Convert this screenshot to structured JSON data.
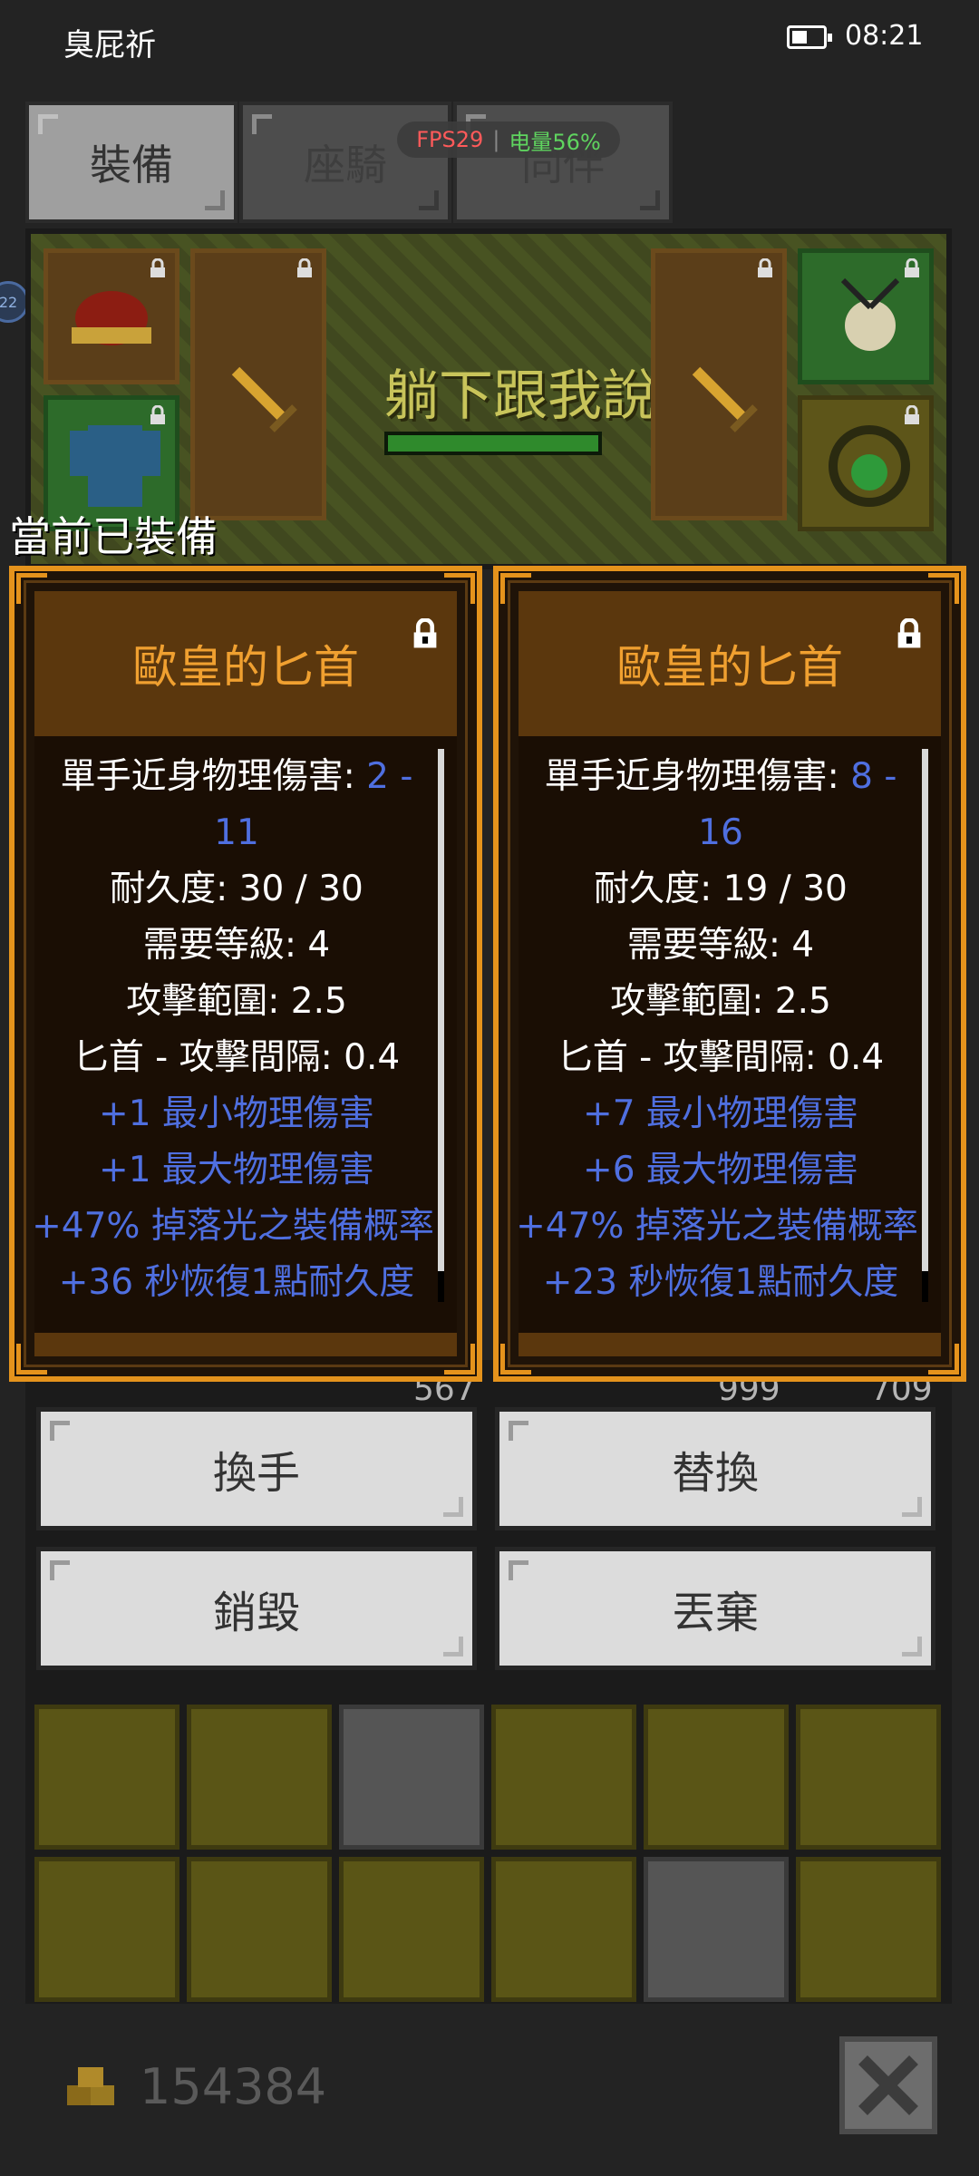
{
  "status_bar": {
    "carrier": "臭屁祈",
    "time": "08:21",
    "battery_icon": "battery-icon"
  },
  "overlay": {
    "fps": "FPS29",
    "separator": "|",
    "battery": "电量56%"
  },
  "tabs": [
    {
      "label": "裝備",
      "active": true
    },
    {
      "label": "座騎",
      "active": false
    },
    {
      "label": "同伴",
      "active": false
    }
  ],
  "scene": {
    "title": "躺下跟我說",
    "hp_fraction": 1.0
  },
  "equipped_caption": "當前已裝備",
  "cards": [
    {
      "name": "歐皇的匕首",
      "lines": [
        {
          "label": "單手近身物理傷害: ",
          "value": "2 - 11"
        },
        {
          "text": "耐久度: 30 / 30"
        },
        {
          "text": "需要等級: 4"
        },
        {
          "text": "攻擊範圍: 2.5"
        },
        {
          "text": "匕首 - 攻擊間隔: 0.4"
        }
      ],
      "bonuses": [
        "+1 最小物理傷害",
        "+1 最大物理傷害",
        "+47% 掉落光之裝備概率",
        "+36 秒恢復1點耐久度"
      ]
    },
    {
      "name": "歐皇的匕首",
      "lines": [
        {
          "label": "單手近身物理傷害: ",
          "value": "8 - 16"
        },
        {
          "text": "耐久度: 19 / 30"
        },
        {
          "text": "需要等級: 4"
        },
        {
          "text": "攻擊範圍: 2.5"
        },
        {
          "text": "匕首 - 攻擊間隔: 0.4"
        }
      ],
      "bonuses": [
        "+7 最小物理傷害",
        "+6 最大物理傷害",
        "+47% 掉落光之裝備概率",
        "+23 秒恢復1點耐久度"
      ]
    }
  ],
  "board_counts": [
    "567",
    "999",
    "709"
  ],
  "actions": {
    "swap_hand": "換手",
    "replace": "替換",
    "destroy": "銷毀",
    "discard": "丟棄"
  },
  "footer": {
    "gold": "154384",
    "close_icon": "close-icon"
  },
  "colors": {
    "card_border": "#e5931c",
    "card_title": "#f0a030",
    "stat_blue": "#4f6fe0"
  }
}
